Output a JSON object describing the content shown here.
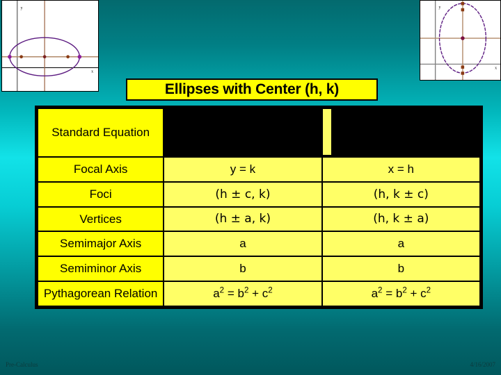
{
  "slide": {
    "title": "Ellipses with Center (h, k)",
    "background_top_color": "#036a6e",
    "background_mid_color": "#12e2e8",
    "background_bottom_color": "#01575c",
    "accent_yellow": "#ffff00",
    "cell_yellow": "#ffff66"
  },
  "graphs": {
    "left": {
      "name": "horizontal-ellipse-graph",
      "x_axis_label": "x",
      "y_axis_label": "y",
      "orientation": "horizontal"
    },
    "right": {
      "name": "vertical-ellipse-graph",
      "x_axis_label": "x",
      "y_axis_label": "y",
      "orientation": "vertical"
    }
  },
  "table": {
    "columns": [
      "",
      "horizontal",
      "vertical"
    ],
    "rows": [
      {
        "label": "Standard Equation",
        "horizontal": "",
        "vertical": "",
        "blacked_out": true
      },
      {
        "label": "Focal Axis",
        "horizontal": "y = k",
        "vertical": "x = h",
        "blacked_out": false
      },
      {
        "label": "Foci",
        "horizontal": "(h ± c, k)",
        "vertical": "(h, k ± c)",
        "blacked_out": false
      },
      {
        "label": "Vertices",
        "horizontal": "(h ± a, k)",
        "vertical": "(h, k ± a)",
        "blacked_out": false
      },
      {
        "label": "Semimajor Axis",
        "horizontal": "a",
        "vertical": "a",
        "blacked_out": false
      },
      {
        "label": "Semiminor Axis",
        "horizontal": "b",
        "vertical": "b",
        "blacked_out": false
      },
      {
        "label": "Pythagorean Relation",
        "horizontal": "a2 = b2 + c2",
        "vertical": "a2 = b2 + c2",
        "blacked_out": false
      }
    ]
  },
  "footer": {
    "left": "Pre-Calculus",
    "right": "4/16/2007"
  }
}
